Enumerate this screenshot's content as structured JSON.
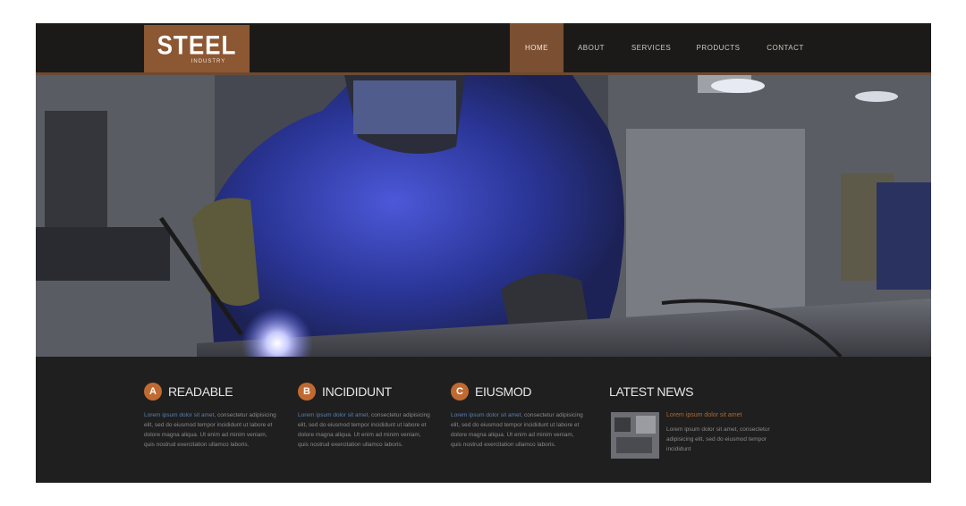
{
  "header": {
    "logo": {
      "main": "STEEL",
      "sub": "INDUSTRY"
    },
    "nav": [
      {
        "label": "HOME",
        "active": true
      },
      {
        "label": "ABOUT",
        "active": false
      },
      {
        "label": "SERVICES",
        "active": false
      },
      {
        "label": "PRODUCTS",
        "active": false
      },
      {
        "label": "CONTACT",
        "active": false
      }
    ]
  },
  "hero": {
    "image": "welder-at-work"
  },
  "features": [
    {
      "letter": "A",
      "title": "READABLE",
      "text_highlight": "Lorem ipsum dolor sit amet,",
      "text": "consectetur adipisicing elit, sed do eiusmod tempor incididunt ut labore et dolore magna aliqua. Ut enim ad minim veniam, quis nostrud exercitation ullamco laboris."
    },
    {
      "letter": "B",
      "title": "INCIDIDUNT",
      "text_highlight": "Lorem ipsum dolor sit amet,",
      "text": "consectetur adipisicing elit, sed do eiusmod tempor incididunt ut labore et dolore magna aliqua. Ut enim ad minim veniam, quis nostrud exercitation ullamco laboris."
    },
    {
      "letter": "C",
      "title": "EIUSMOD",
      "text_highlight": "Lorem ipsum dolor sit amet,",
      "text": "consectetur adipisicing elit, sed do eiusmod tempor incididunt ut labore et dolore magna aliqua. Ut enim ad minim veniam, quis nostrud exercitation ullamco laboris."
    }
  ],
  "news": {
    "heading": "LATEST NEWS",
    "item_title": "Lorem ipsum dolor sit amet",
    "item_text": "Lorem ipsum dolor sit amet, consectetur adipisicing elit, sed do eiusmod tempor incididunt"
  },
  "colors": {
    "accent": "#8c5733",
    "badge": "#c06a32",
    "dark": "#1f1f1f"
  }
}
